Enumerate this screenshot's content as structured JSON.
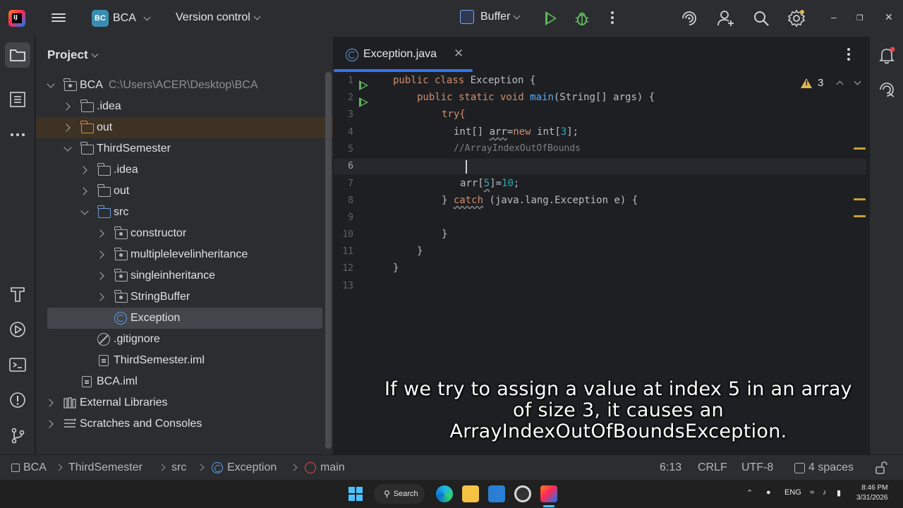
{
  "titlebar": {
    "project_badge": "BC",
    "project_name": "BCA",
    "vcs_label": "Version control",
    "run_config": "Buffer"
  },
  "project_panel": {
    "title": "Project",
    "tree": [
      {
        "label": "BCA",
        "path": "C:\\Users\\ACER\\Desktop\\BCA"
      },
      {
        "label": ".idea"
      },
      {
        "label": "out"
      },
      {
        "label": "ThirdSemester"
      },
      {
        "label": ".idea"
      },
      {
        "label": "out"
      },
      {
        "label": "src"
      },
      {
        "label": "constructor"
      },
      {
        "label": "multiplelevelinheritance"
      },
      {
        "label": "singleinheritance"
      },
      {
        "label": "StringBuffer"
      },
      {
        "label": "Exception"
      },
      {
        "label": ".gitignore"
      },
      {
        "label": "ThirdSemester.iml"
      },
      {
        "label": "BCA.iml"
      },
      {
        "label": "External Libraries"
      },
      {
        "label": "Scratches and Consoles"
      }
    ]
  },
  "editor": {
    "tab_label": "Exception.java",
    "warning_count": "3",
    "line_numbers": [
      "1",
      "2",
      "3",
      "4",
      "5",
      "6",
      "7",
      "8",
      "9",
      "10",
      "11",
      "12",
      "13"
    ],
    "code": {
      "l1_kw": "public class ",
      "l1_rest": "Exception {",
      "l2_kw": "public static void ",
      "l2_fn": "main",
      "l2_rest": "(String[] args) {",
      "l3": "try{",
      "l4_a": "int[] ",
      "l4_var": "arr",
      "l4_b": "=",
      "l4_kw": "new ",
      "l4_c": "int[",
      "l4_num": "3",
      "l4_d": "];",
      "l5": "//ArrayIndexOutOfBounds",
      "l7_a": "arr[",
      "l7_num1": "5",
      "l7_b": "]=",
      "l7_num2": "10",
      "l7_c": ";",
      "l8_a": "} ",
      "l8_kw": "catch",
      "l8_b": " (java.lang.Exception e) {",
      "l10": "}",
      "l11": "}",
      "l12": "}"
    },
    "subtitle": [
      "If we try to assign a value at index 5 in an array",
      "of size 3, it causes an",
      "ArrayIndexOutOfBoundsException."
    ]
  },
  "statusbar": {
    "breadcrumbs": [
      "BCA",
      "ThirdSemester",
      "src",
      "Exception",
      "main"
    ],
    "position": "6:13",
    "line_sep": "CRLF",
    "encoding": "UTF-8",
    "indent": "4 spaces"
  },
  "taskbar": {
    "search": "Search",
    "lang": "ENG",
    "time": "8:46 PM",
    "date": "3/31/2026"
  }
}
